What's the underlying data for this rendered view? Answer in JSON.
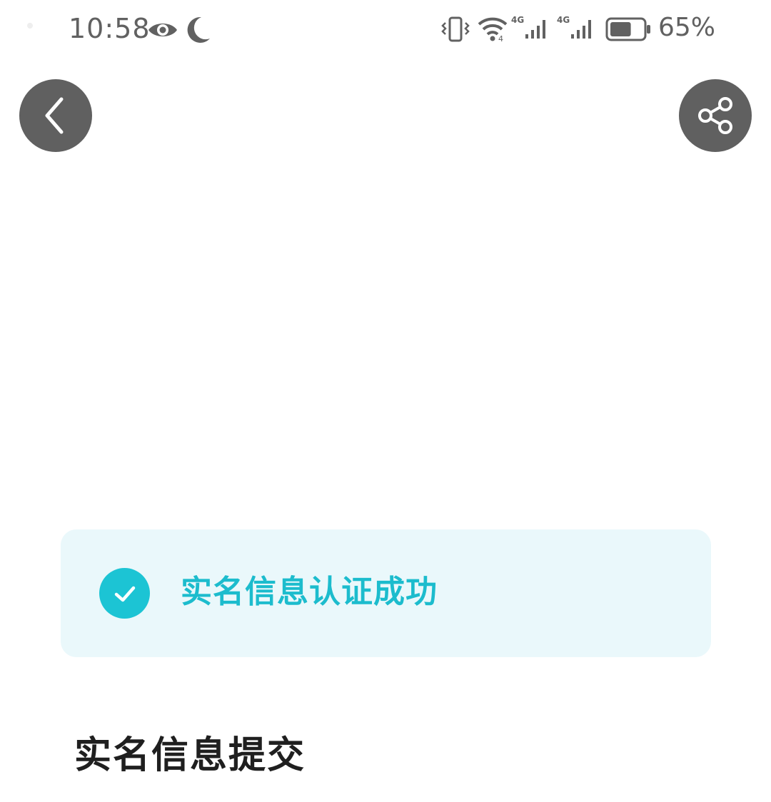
{
  "status_bar": {
    "time": "10:58",
    "battery_percent": "65%",
    "battery_level": 0.65,
    "network_1": "4G",
    "network_2": "4G",
    "icons": [
      "eye-icon",
      "moon-icon",
      "vibrate-icon",
      "wifi-icon",
      "signal-icon",
      "signal-icon",
      "battery-icon"
    ]
  },
  "header": {
    "back_icon": "chevron-left-icon",
    "share_icon": "share-icon"
  },
  "success_card": {
    "message": "实名信息认证成功",
    "icon": "check-icon"
  },
  "section": {
    "title": "实名信息提交"
  },
  "colors": {
    "accent": "#1cc4d4",
    "card_background": "#eaf8fb",
    "button_background": "#606060",
    "heading": "#1f1f1f",
    "status_text": "#616161"
  }
}
